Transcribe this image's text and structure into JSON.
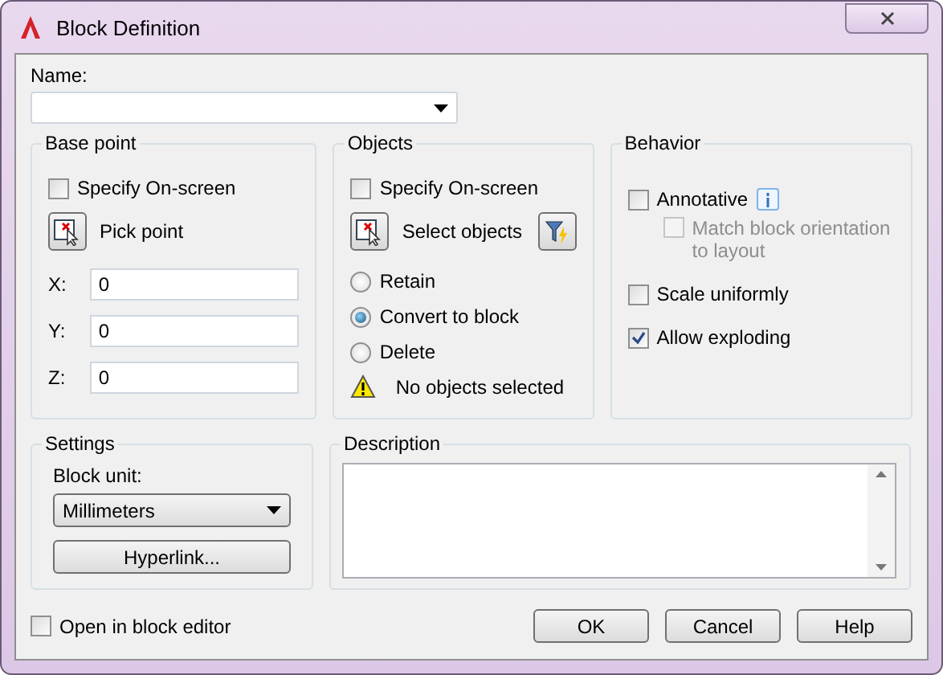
{
  "window": {
    "title": "Block Definition"
  },
  "name_field": {
    "label": "Name:"
  },
  "base_point": {
    "title": "Base point",
    "specify": {
      "label": "Specify On-screen",
      "checked": false
    },
    "pick_button": "Pick point",
    "coords": [
      {
        "label": "X:",
        "value": "0"
      },
      {
        "label": "Y:",
        "value": "0"
      },
      {
        "label": "Z:",
        "value": "0"
      }
    ]
  },
  "objects": {
    "title": "Objects",
    "specify": {
      "label": "Specify On-screen",
      "checked": false
    },
    "select_button": "Select objects",
    "radios": [
      {
        "label": "Retain",
        "selected": false
      },
      {
        "label": "Convert to block",
        "selected": true
      },
      {
        "label": "Delete",
        "selected": false
      }
    ],
    "warning": "No objects selected"
  },
  "behavior": {
    "title": "Behavior",
    "options": [
      {
        "label": "Annotative",
        "checked": false,
        "disabled": false,
        "children": [
          {
            "label": "Match block orientation to layout",
            "checked": false,
            "disabled": true
          }
        ]
      },
      {
        "label": "Scale uniformly",
        "checked": false,
        "disabled": false
      },
      {
        "label": "Allow exploding",
        "checked": true,
        "disabled": false
      }
    ]
  },
  "settings": {
    "title": "Settings",
    "unit_label": "Block unit:",
    "unit_value": "Millimeters",
    "hyperlink_button": "Hyperlink..."
  },
  "description": {
    "title": "Description"
  },
  "open_in_editor": {
    "label": "Open in block editor",
    "checked": false
  },
  "buttons": [
    "OK",
    "Cancel",
    "Help"
  ]
}
